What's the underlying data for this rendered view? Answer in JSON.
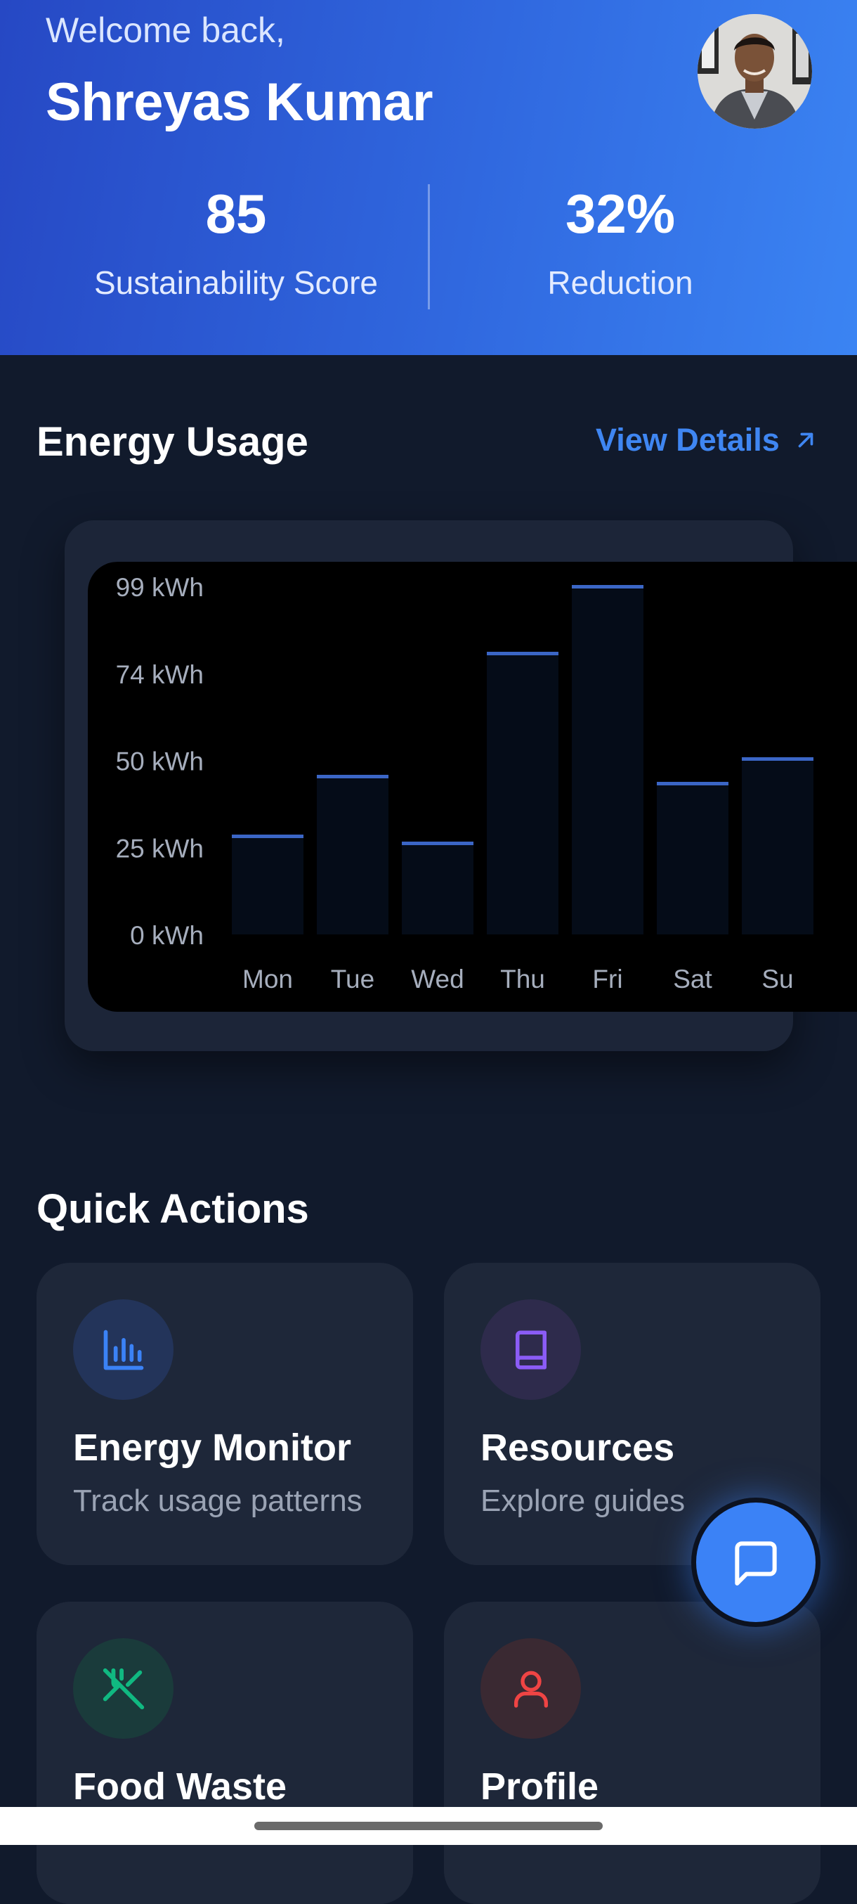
{
  "header": {
    "welcome": "Welcome back,",
    "user_name": "Shreyas Kumar",
    "stats": [
      {
        "value": "85",
        "label": "Sustainability Score"
      },
      {
        "value": "32%",
        "label": "Reduction"
      }
    ]
  },
  "energy": {
    "title": "Energy Usage",
    "view_details": "View Details",
    "view_details_icon": "arrow-up-right-icon"
  },
  "chart_data": {
    "type": "bar",
    "categories": [
      "Mon",
      "Tue",
      "Wed",
      "Thu",
      "Fri",
      "Sat",
      "Su"
    ],
    "values": [
      28,
      45,
      26,
      80,
      99,
      43,
      50
    ],
    "y_ticks": [
      "99 kWh",
      "74 kWh",
      "50 kWh",
      "25 kWh",
      "0 kWh"
    ],
    "ylim": [
      0,
      99
    ],
    "grid": false,
    "colors": {
      "bar": "#050c18",
      "bar_top": "#3b66c6",
      "tick": "#a6aebd",
      "background": "#000000"
    }
  },
  "quick_actions": {
    "title": "Quick Actions",
    "items": [
      {
        "name": "Energy Monitor",
        "desc": "Track usage patterns",
        "icon": "bar-chart-icon",
        "color": "#3b82f6",
        "bg": "#23345a"
      },
      {
        "name": "Resources",
        "desc": "Explore guides",
        "icon": "book-icon",
        "color": "#8b5cf6",
        "bg": "#2e2b4c"
      },
      {
        "name": "Food Waste",
        "desc": "",
        "icon": "fork-knife-off-icon",
        "color": "#10b981",
        "bg": "#1a3b3b"
      },
      {
        "name": "Profile",
        "desc": "",
        "icon": "user-icon",
        "color": "#ef4444",
        "bg": "#3a2932"
      }
    ]
  },
  "fab": {
    "icon": "chat-bubble-icon"
  }
}
